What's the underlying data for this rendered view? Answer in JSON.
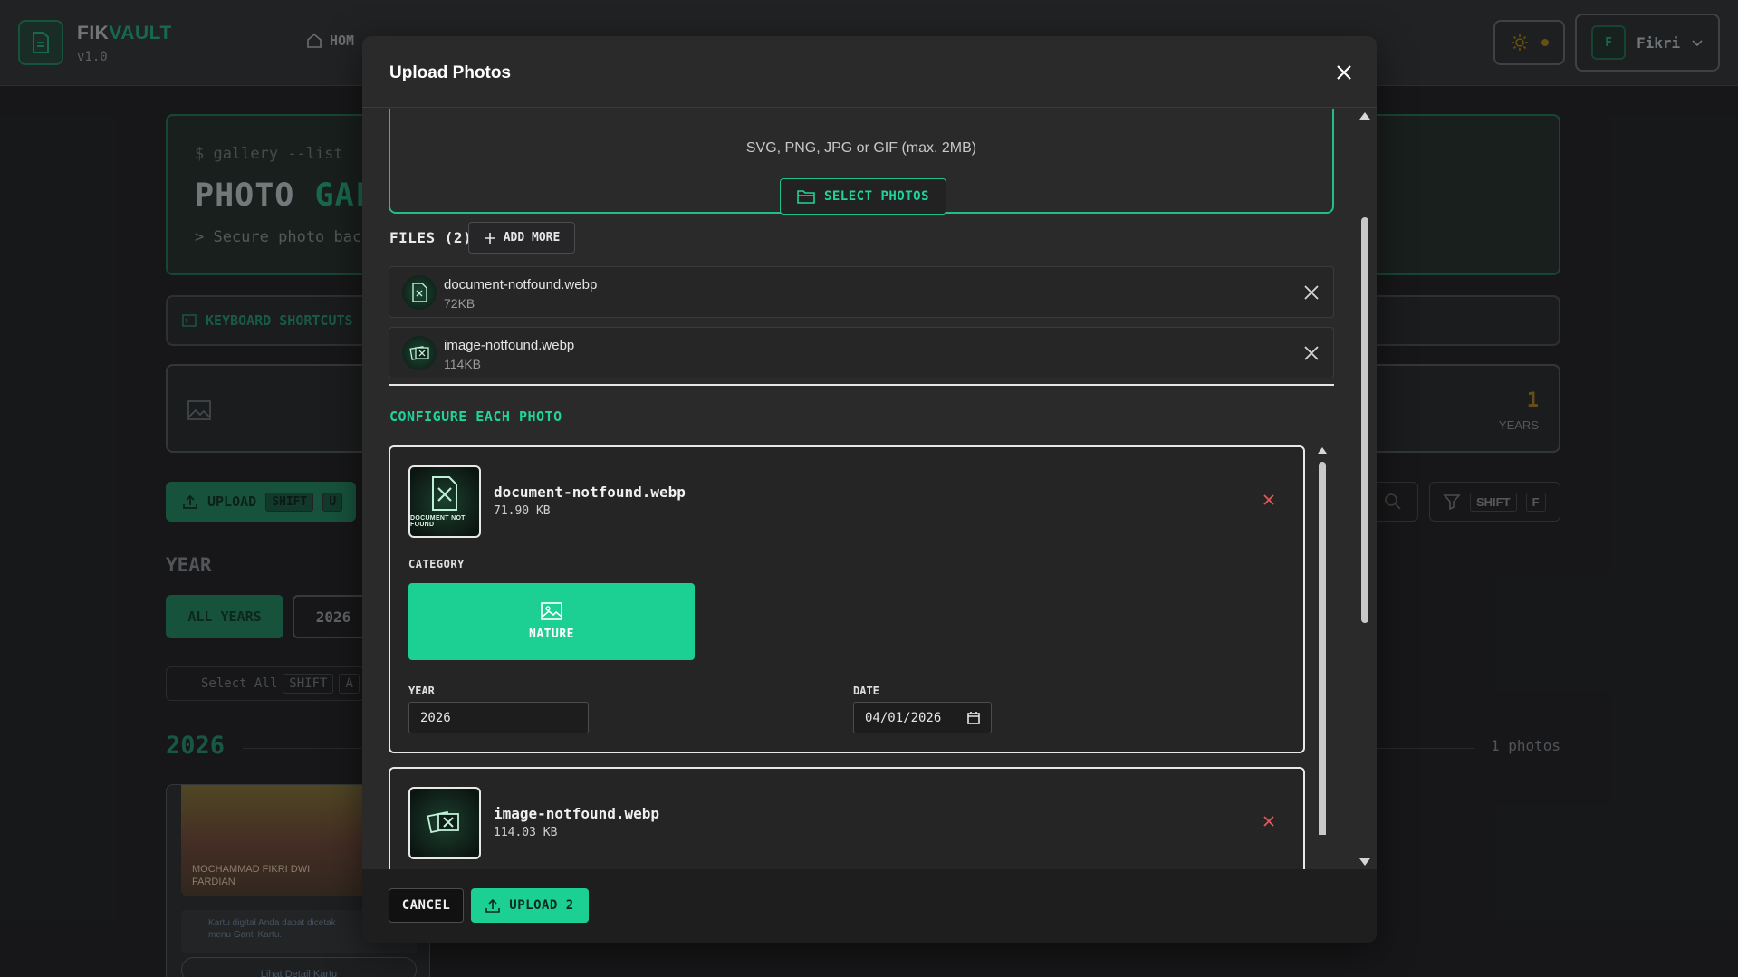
{
  "app": {
    "name_prefix": "FIK",
    "name_accent": "VAULT",
    "version": "v1.0",
    "nav_home": "HOM",
    "user_initial": "F",
    "user_name": "Fikri"
  },
  "background": {
    "hero_cmd": "$ gallery --list",
    "hero_title_prefix": "PHOTO ",
    "hero_title_accent": "GAL",
    "hero_sub": "> Secure photo back",
    "shortcuts_label": "KEYBOARD SHORTCUTS",
    "stat_value": "1",
    "stat_label": "YEARS",
    "upload_label": "UPLOAD",
    "upload_kbd1": "SHIFT",
    "upload_kbd2": "U",
    "filter_kbd1": "SHIFT",
    "filter_kbd2": "F",
    "year_heading": "YEAR",
    "all_years": "ALL YEARS",
    "year_option": "2026",
    "select_all": "Select All",
    "select_kbd1": "SHIFT",
    "select_kbd2": "A",
    "section_year": "2026",
    "section_count": "1 photos",
    "card_image_text_1": "MOCHAMMAD FIKRI DWI",
    "card_image_text_2": "FARDIAN",
    "card_note_1": "Kartu digital Anda dapat dicetak",
    "card_note_2": "menu Ganti Kartu.",
    "card_link": "Lihat Detail Kartu"
  },
  "modal": {
    "title": "Upload Photos",
    "dropzone_hint": "SVG, PNG, JPG or GIF (max. 2MB)",
    "select_photos": "SELECT PHOTOS",
    "files_heading": "FILES (2)",
    "add_more": "ADD MORE",
    "files": [
      {
        "name": "document-notfound.webp",
        "size": "72KB"
      },
      {
        "name": "image-notfound.webp",
        "size": "114KB"
      }
    ],
    "configure_heading": "CONFIGURE EACH PHOTO",
    "configs": [
      {
        "name": "document-notfound.webp",
        "size": "71.90 KB",
        "thumb_caption": "DOCUMENT NOT FOUND",
        "category_label": "CATEGORY",
        "category": "NATURE",
        "year_label": "YEAR",
        "year": "2026",
        "date_label": "DATE",
        "date": "04/01/2026"
      },
      {
        "name": "image-notfound.webp",
        "size": "114.03 KB"
      }
    ],
    "cancel": "CANCEL",
    "upload": "UPLOAD 2"
  },
  "colors": {
    "accent": "#1ccf92",
    "delete": "#e05a5a",
    "modal_bg": "#2a2a2b"
  }
}
